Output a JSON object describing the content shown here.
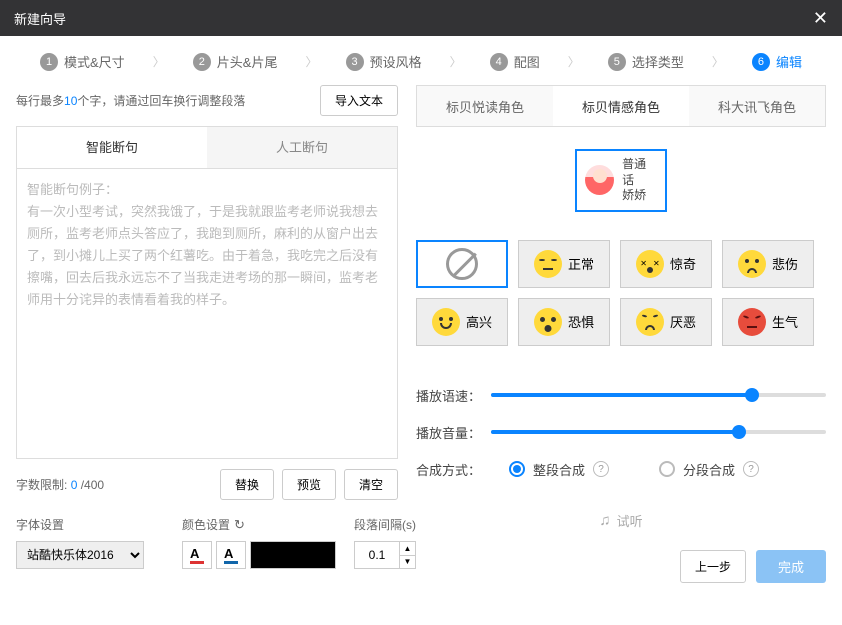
{
  "title": "新建向导",
  "steps": [
    {
      "num": "1",
      "label": "模式&尺寸"
    },
    {
      "num": "2",
      "label": "片头&片尾"
    },
    {
      "num": "3",
      "label": "预设风格"
    },
    {
      "num": "4",
      "label": "配图"
    },
    {
      "num": "5",
      "label": "选择类型"
    },
    {
      "num": "6",
      "label": "编辑"
    }
  ],
  "import_hint_pre": "每行最多",
  "import_hint_num": "10",
  "import_hint_post": "个字，请通过回车换行调整段落",
  "import_btn": "导入文本",
  "left_tabs": {
    "smart": "智能断句",
    "manual": "人工断句"
  },
  "placeholder": "智能断句例子：\n有一次小型考试，突然我饿了，于是我就跟监考老师说我想去厕所，监考老师点头答应了，我跑到厕所，麻利的从窗户出去了，到小摊儿上买了两个红薯吃。由于着急，我吃完之后没有擦嘴，回去后我永远忘不了当我走进考场的那一瞬间，监考老师用十分诧异的表情看着我的样子。",
  "count_label": "字数限制:",
  "count_cur": "0",
  "count_max": " /400",
  "btn_replace": "替换",
  "btn_preview": "预览",
  "btn_clear": "清空",
  "font_label": "字体设置",
  "color_label": "颜色设置",
  "para_label": "段落间隔(s)",
  "font_value": "站酷快乐体2016",
  "spinner_value": "0.1",
  "right_tabs": {
    "t1": "标贝悦读角色",
    "t2": "标贝情感角色",
    "t3": "科大讯飞角色"
  },
  "voice_name": "普通话\n娇娇",
  "emotions": {
    "none": "",
    "normal": "正常",
    "surprise": "惊奇",
    "sad": "悲伤",
    "happy": "高兴",
    "fear": "恐惧",
    "disgust": "厌恶",
    "angry": "生气"
  },
  "speed_label": "播放语速：",
  "volume_label": "播放音量：",
  "synth_label": "合成方式：",
  "synth_whole": "整段合成",
  "synth_split": "分段合成",
  "listen": "试听",
  "prev_btn": "上一步",
  "done_btn": "完成",
  "slider_speed_pct": 78,
  "slider_volume_pct": 74
}
